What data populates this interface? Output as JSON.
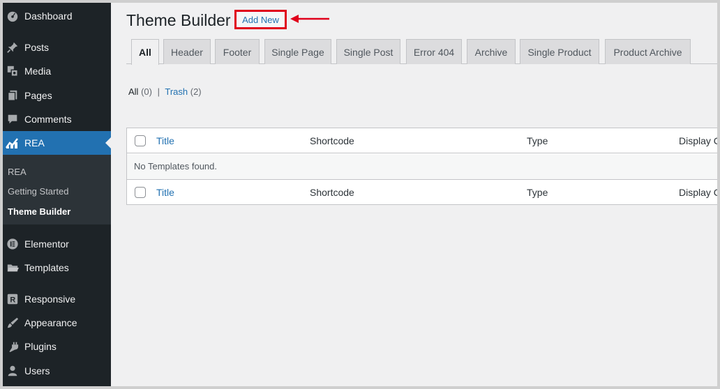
{
  "sidebar": {
    "items": [
      {
        "label": "Dashboard",
        "icon": "dashboard-icon"
      },
      {
        "label": "Posts",
        "icon": "pin-icon"
      },
      {
        "label": "Media",
        "icon": "media-icon"
      },
      {
        "label": "Pages",
        "icon": "pages-icon"
      },
      {
        "label": "Comments",
        "icon": "comment-icon"
      },
      {
        "label": "REA",
        "icon": "chart-icon"
      },
      {
        "label": "Elementor",
        "icon": "elementor-icon"
      },
      {
        "label": "Templates",
        "icon": "folder-icon"
      },
      {
        "label": "Responsive",
        "icon": "responsive-r-icon"
      },
      {
        "label": "Appearance",
        "icon": "brush-icon"
      },
      {
        "label": "Plugins",
        "icon": "plug-icon"
      },
      {
        "label": "Users",
        "icon": "user-icon"
      }
    ],
    "submenu": [
      "REA",
      "Getting Started",
      "Theme Builder"
    ]
  },
  "header": {
    "title": "Theme Builder",
    "add_new": "Add New"
  },
  "tabs": [
    "All",
    "Header",
    "Footer",
    "Single Page",
    "Single Post",
    "Error 404",
    "Archive",
    "Single Product",
    "Product Archive"
  ],
  "views": {
    "all": "All",
    "all_count": "(0)",
    "separator": "|",
    "trash": "Trash",
    "trash_count": "(2)"
  },
  "table": {
    "columns": [
      "Title",
      "Shortcode",
      "Type",
      "Display C"
    ],
    "empty_message": "No Templates found."
  },
  "colors": {
    "sidebar_bg": "#1d2327",
    "accent": "#2271b1",
    "highlight": "#e0001b"
  }
}
